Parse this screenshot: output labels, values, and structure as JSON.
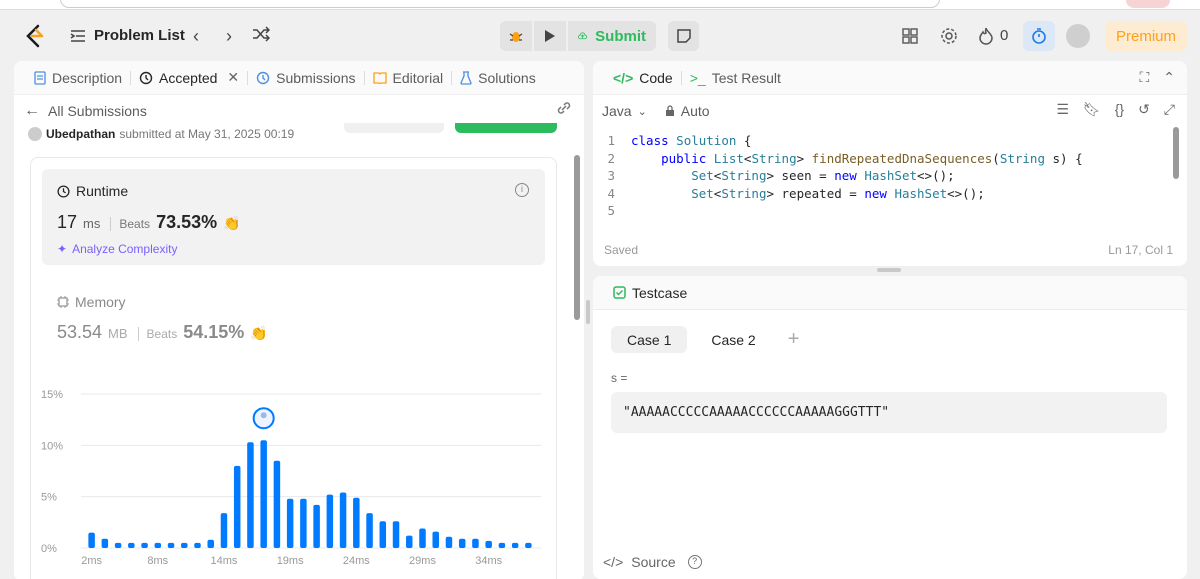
{
  "topnav": {
    "problem_list_label": "Problem List",
    "submit_label": "Submit",
    "fire_count": "0",
    "premium_label": "Premium"
  },
  "left_tabs": {
    "description": "Description",
    "accepted": "Accepted",
    "submissions": "Submissions",
    "editorial": "Editorial",
    "solutions": "Solutions"
  },
  "submission": {
    "back_label": "All Submissions",
    "user": "Ubedpathan",
    "submitted_text": "submitted at May 31, 2025 00:19"
  },
  "runtime": {
    "title": "Runtime",
    "value": "17",
    "unit": "ms",
    "beats_label": "Beats",
    "beats_pct": "73.53%",
    "analyze_label": "Analyze Complexity"
  },
  "memory": {
    "title": "Memory",
    "value": "53.54",
    "unit": "MB",
    "beats_label": "Beats",
    "beats_pct": "54.15%"
  },
  "chart_data": {
    "type": "bar",
    "y_ticks": [
      "15%",
      "10%",
      "5%",
      "0%"
    ],
    "ylim": [
      0,
      15
    ],
    "x_tick_labels": [
      "2ms",
      "8ms",
      "14ms",
      "19ms",
      "24ms",
      "29ms",
      "34ms"
    ],
    "values": [
      1.5,
      0.9,
      0.5,
      0.5,
      0.5,
      0.5,
      0.5,
      0.5,
      0.5,
      0.8,
      3.4,
      8.0,
      10.3,
      10.5,
      8.5,
      4.8,
      4.8,
      4.2,
      5.2,
      5.4,
      4.9,
      3.4,
      2.6,
      2.6,
      1.2,
      1.9,
      1.6,
      1.1,
      0.9,
      0.9,
      0.7,
      0.5,
      0.5,
      0.5
    ],
    "highlight_index": 13,
    "color": "#007aff"
  },
  "code_panel": {
    "code_tab": "Code",
    "test_result_tab": "Test Result",
    "language": "Java",
    "auto_label": "Auto",
    "saved_label": "Saved",
    "cursor_pos": "Ln 17, Col 1",
    "lines": [
      "1",
      "2",
      "3",
      "4",
      "5"
    ]
  },
  "testcase": {
    "title": "Testcase",
    "case1": "Case 1",
    "case2": "Case 2",
    "var_label": "s =",
    "var_value": "\"AAAAACCCCCAAAAACCCCCCAAAAAGGGTTT\"",
    "source_label": "Source"
  }
}
